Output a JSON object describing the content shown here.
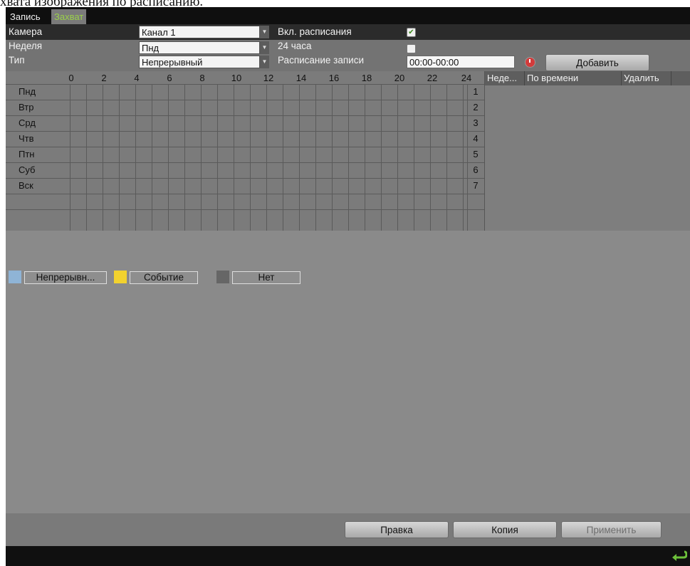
{
  "document_text": "хвата изображения по расписанию.",
  "tabs": [
    {
      "label": "Запись"
    },
    {
      "label": "Захват"
    }
  ],
  "form": {
    "camera_label": "Камера",
    "camera_value": "Канал 1",
    "schedule_enable_label": "Вкл. расписания",
    "schedule_enable_checked": true,
    "week_label": "Неделя",
    "week_value": "Пнд",
    "all_day_label": "24 часа",
    "all_day_checked": false,
    "type_label": "Тип",
    "type_value": "Непрерывный",
    "record_schedule_label": "Расписание записи",
    "record_schedule_value": "00:00-00:00",
    "add_button": "Добавить"
  },
  "schedule_grid": {
    "hour_labels": [
      "0",
      "2",
      "4",
      "6",
      "8",
      "10",
      "12",
      "14",
      "16",
      "18",
      "20",
      "22",
      "24"
    ],
    "days": [
      {
        "name": "Пнд",
        "num": "1"
      },
      {
        "name": "Втр",
        "num": "2"
      },
      {
        "name": "Срд",
        "num": "3"
      },
      {
        "name": "Чтв",
        "num": "4"
      },
      {
        "name": "Птн",
        "num": "5"
      },
      {
        "name": "Суб",
        "num": "6"
      },
      {
        "name": "Вск",
        "num": "7"
      }
    ]
  },
  "side_table": {
    "columns": [
      "Неде...",
      "По времени",
      "Удалить"
    ]
  },
  "legend": [
    {
      "label": "Непрерывн...",
      "color": "#8fb4d6"
    },
    {
      "label": "Событие",
      "color": "#f2d22e"
    },
    {
      "label": "Нет",
      "color": "#666666"
    }
  ],
  "buttons": {
    "edit": "Правка",
    "copy": "Копия",
    "apply": "Применить"
  },
  "colors": {
    "tab_inactive_text": "#9ad04a",
    "grid_line": "#5a5a5a"
  }
}
